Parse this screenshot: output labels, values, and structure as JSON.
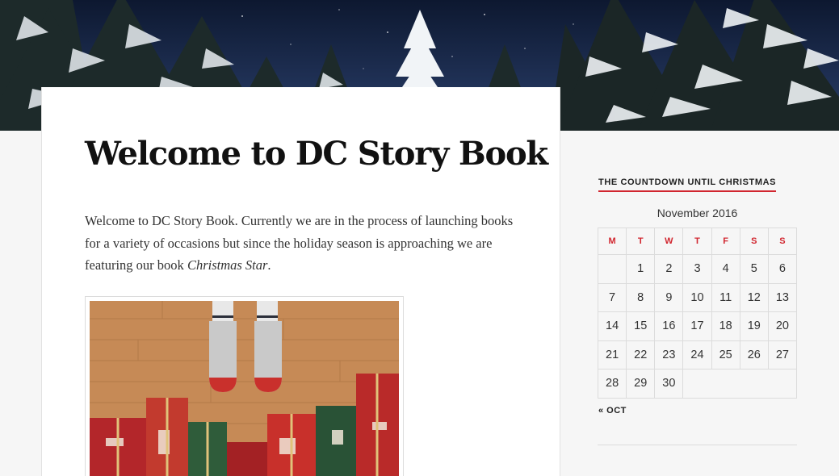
{
  "page": {
    "title": "Welcome to DC Story Book",
    "intro_before": "Welcome to DC Story Book. Currently we are in the process of launching books for a variety of occasions but since the holiday season is approaching we are featuring our book ",
    "intro_book": "Christmas Star",
    "intro_after": "."
  },
  "sidebar": {
    "widget_title": "THE COUNTDOWN UNTIL CHRISTMAS",
    "calendar": {
      "caption": "November 2016",
      "weekdays": [
        "M",
        "T",
        "W",
        "T",
        "F",
        "S",
        "S"
      ],
      "weeks": [
        [
          "",
          "1",
          "2",
          "3",
          "4",
          "5",
          "6"
        ],
        [
          "7",
          "8",
          "9",
          "10",
          "11",
          "12",
          "13"
        ],
        [
          "14",
          "15",
          "16",
          "17",
          "18",
          "19",
          "20"
        ],
        [
          "21",
          "22",
          "23",
          "24",
          "25",
          "26",
          "27"
        ],
        [
          "28",
          "29",
          "30",
          "",
          "",
          "",
          ""
        ]
      ],
      "prev_link": "« OCT"
    }
  },
  "colors": {
    "accent": "#d1262f",
    "text": "#333333",
    "title": "#111111",
    "background": "#f6f6f6"
  }
}
